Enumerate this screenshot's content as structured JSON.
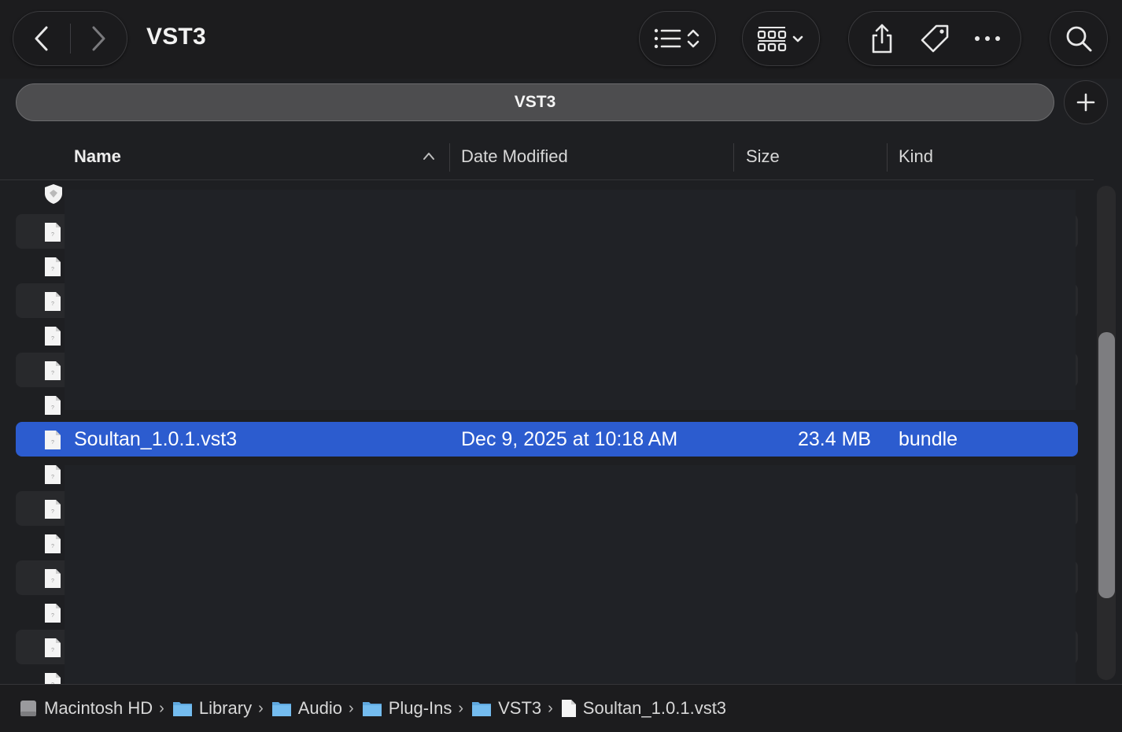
{
  "window": {
    "title": "VST3"
  },
  "pathbar": {
    "label": "VST3"
  },
  "columns": {
    "name": "Name",
    "date": "Date Modified",
    "size": "Size",
    "kind": "Kind"
  },
  "selected_row": {
    "name": "Soultan_1.0.1.vst3",
    "date": "Dec 9, 2025 at 10:18 AM",
    "size": "23.4 MB",
    "kind": "bundle"
  },
  "breadcrumb": [
    {
      "label": "Macintosh HD",
      "icon": "disk-icon"
    },
    {
      "label": "Library",
      "icon": "folder-icon"
    },
    {
      "label": "Audio",
      "icon": "folder-icon"
    },
    {
      "label": "Plug-Ins",
      "icon": "folder-icon"
    },
    {
      "label": "VST3",
      "icon": "folder-icon"
    },
    {
      "label": "Soultan_1.0.1.vst3",
      "icon": "file-icon"
    }
  ],
  "colors": {
    "selection": "#2c5ccf",
    "background": "#1e1f22",
    "folder": "#6cb6ea"
  }
}
